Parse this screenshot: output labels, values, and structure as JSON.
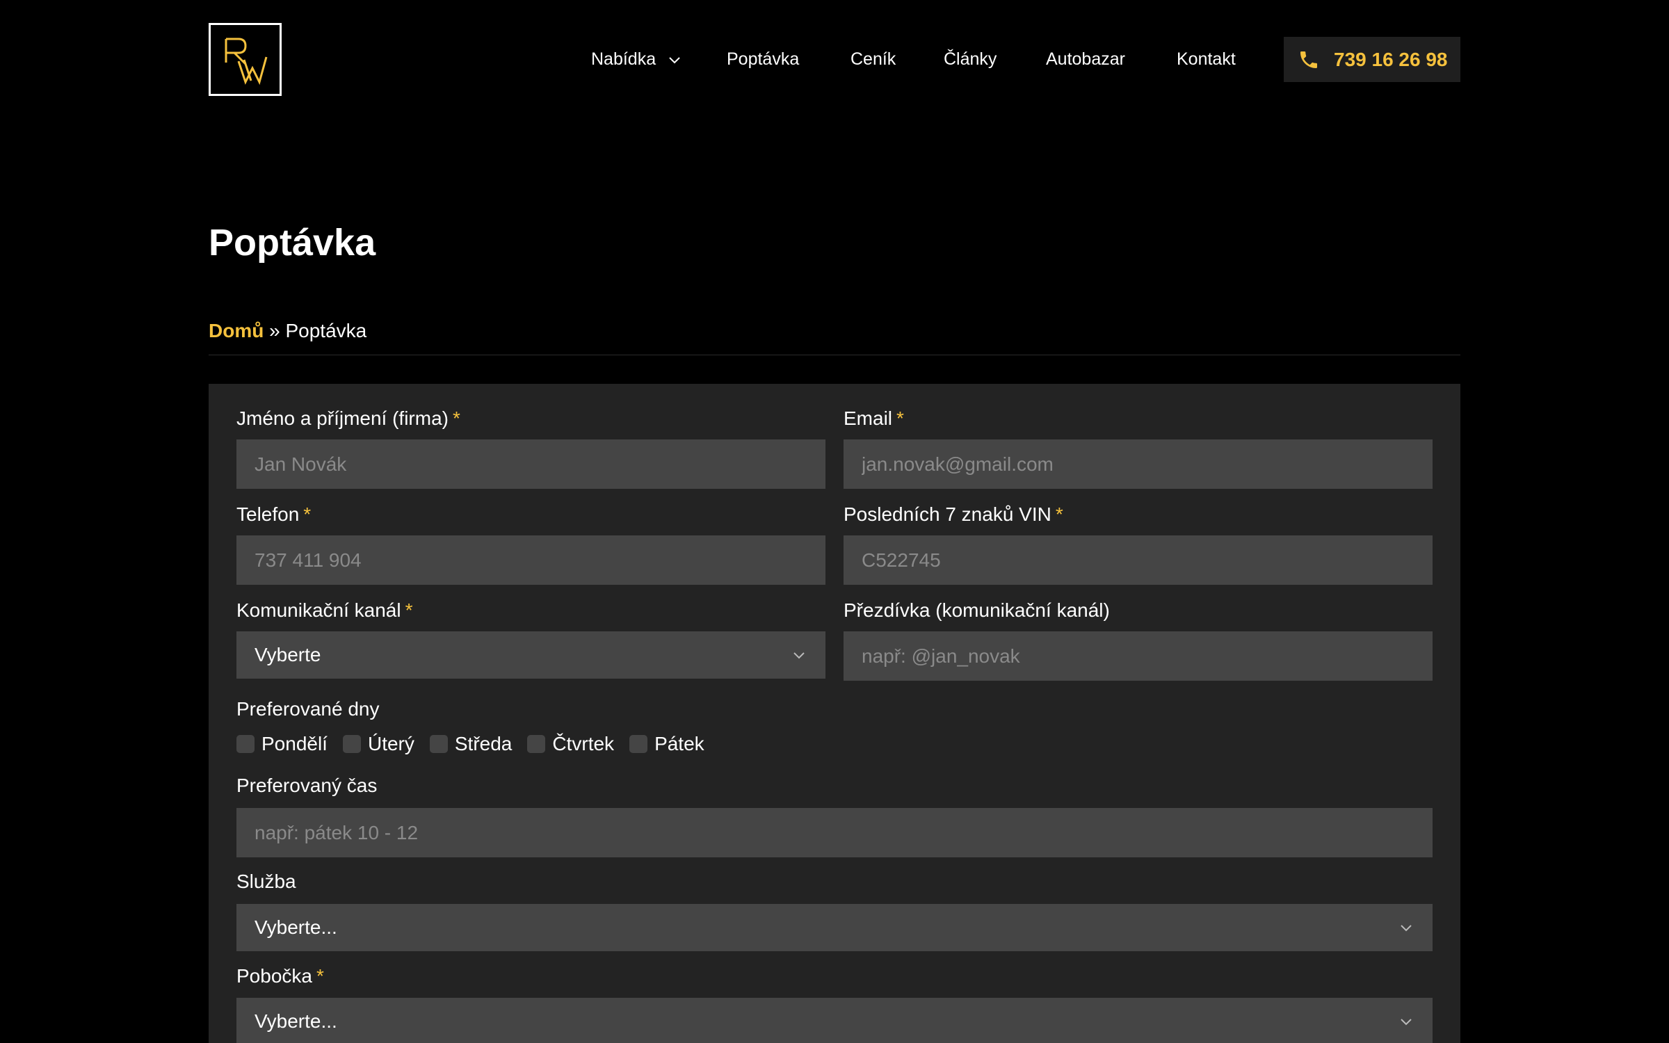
{
  "header": {
    "nav": [
      {
        "label": "Nabídka",
        "has_dropdown": true
      },
      {
        "label": "Poptávka"
      },
      {
        "label": "Ceník"
      },
      {
        "label": "Články"
      },
      {
        "label": "Autobazar"
      },
      {
        "label": "Kontakt"
      }
    ],
    "phone": "739 16 26 98"
  },
  "page": {
    "title": "Poptávka",
    "breadcrumb": {
      "home": "Domů",
      "separator": "»",
      "current": "Poptávka"
    }
  },
  "form": {
    "name": {
      "label": "Jméno a příjmení (firma)",
      "required": "*",
      "placeholder": "Jan Novák"
    },
    "email": {
      "label": "Email",
      "required": "*",
      "placeholder": "jan.novak@gmail.com"
    },
    "phone": {
      "label": "Telefon",
      "required": "*",
      "placeholder": "737 411 904"
    },
    "vin": {
      "label": "Posledních 7 znaků VIN",
      "required": "*",
      "placeholder": "C522745"
    },
    "channel": {
      "label": "Komunikační kanál",
      "required": "*",
      "value": "Vyberte"
    },
    "nickname": {
      "label": "Přezdívka (komunikační kanál)",
      "placeholder": "např: @jan_novak"
    },
    "days": {
      "label": "Preferované dny",
      "options": [
        "Pondělí",
        "Úterý",
        "Středa",
        "Čtvrtek",
        "Pátek"
      ]
    },
    "time": {
      "label": "Preferovaný čas",
      "placeholder": "např: pátek 10 - 12"
    },
    "service": {
      "label": "Služba",
      "value": "Vyberte..."
    },
    "branch": {
      "label": "Pobočka",
      "required": "*",
      "value": "Vyberte..."
    }
  },
  "colors": {
    "accent": "#f5c13d",
    "background": "#000000",
    "panel": "#232323",
    "field": "#454545"
  },
  "icons": {
    "phone": "phone-icon",
    "dropdown": "chevron-down-icon"
  }
}
